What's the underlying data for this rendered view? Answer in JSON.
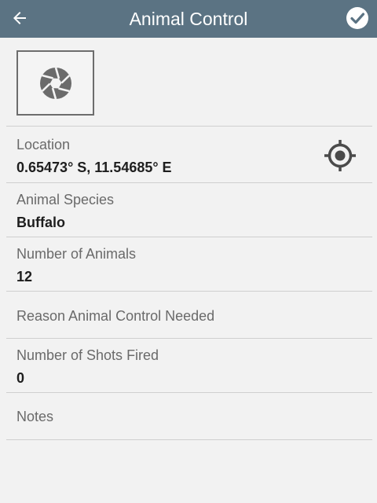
{
  "header": {
    "title": "Animal Control",
    "back_icon": "arrow-left-icon",
    "save_icon": "check-circle-icon",
    "background": "#5b7383"
  },
  "photo": {
    "icon": "camera-shutter-icon"
  },
  "fields": [
    {
      "label": "Location",
      "value": "0.65473° S, 11.54685° E",
      "icon": "gps-target-icon"
    },
    {
      "label": "Animal Species",
      "value": "Buffalo"
    },
    {
      "label": "Number of Animals",
      "value": "12"
    },
    {
      "label": "Reason Animal Control Needed",
      "value": ""
    },
    {
      "label": "Number of Shots Fired",
      "value": "0"
    },
    {
      "label": "Notes",
      "value": ""
    }
  ]
}
